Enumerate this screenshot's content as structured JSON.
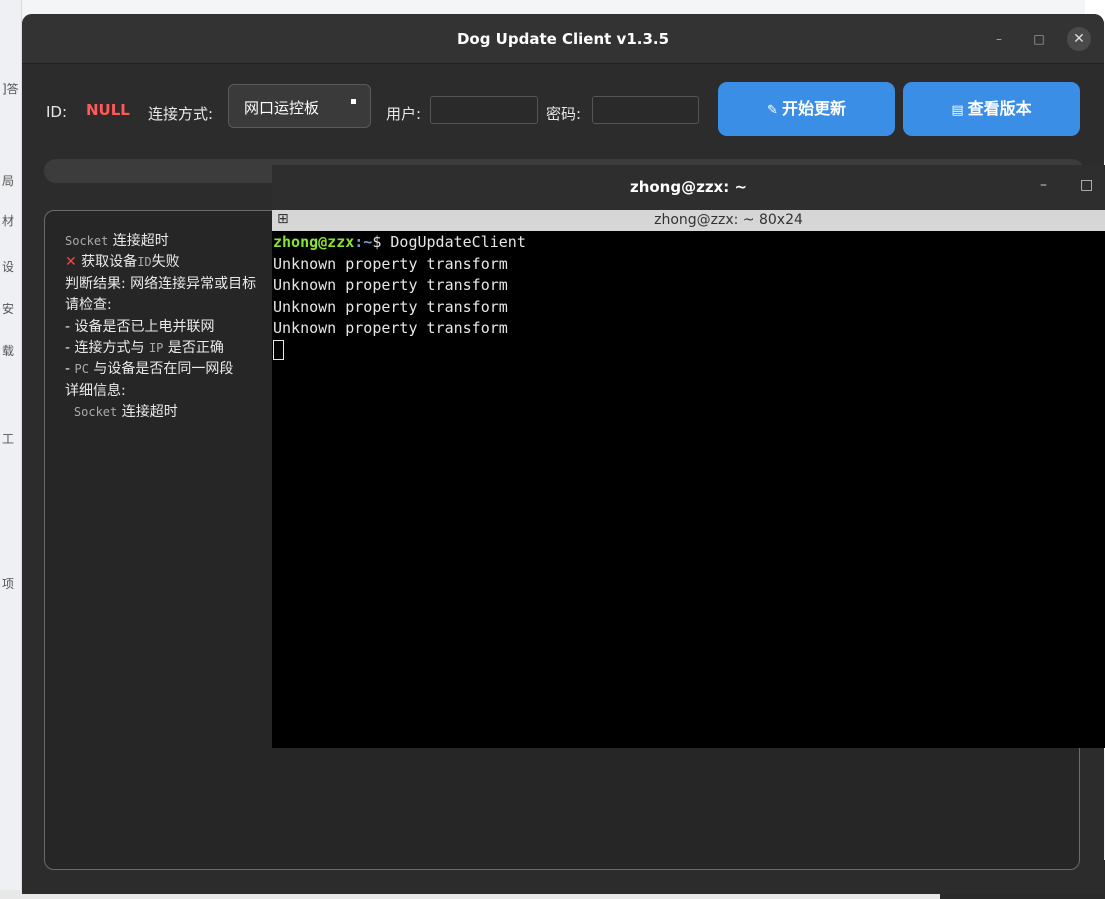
{
  "app": {
    "title": "Dog Update Client v1.3.5",
    "minimize": "–",
    "maximize": "□",
    "close": "✕"
  },
  "toolbar": {
    "id_label": "ID:",
    "id_value": "NULL",
    "conn_label": "连接方式:",
    "conn_value": "网口运控板",
    "user_label": "用户:",
    "user_value": "",
    "pass_label": "密码:",
    "pass_value": "",
    "start_button": "开始更新",
    "start_icon": "pencil-icon",
    "start_icon_glyph": "✎",
    "version_button": "查看版本",
    "version_icon": "document-icon",
    "version_icon_glyph": "▤"
  },
  "log": {
    "lines": [
      [
        "Socket",
        " 连接超时"
      ],
      [
        "✕",
        " 获取设备",
        "ID",
        "失败"
      ],
      [
        "判断结果: 网络连接异常或目标"
      ],
      [
        "请检查:"
      ],
      [
        "- 设备是否已上电并联网"
      ],
      [
        "- 连接方式与 ",
        "IP",
        " 是否正确"
      ],
      [
        "- ",
        "PC",
        " 与设备是否在同一网段"
      ],
      [
        "详细信息:"
      ],
      [
        "  ",
        "Socket",
        " 连接超时"
      ]
    ]
  },
  "terminal": {
    "title": "zhong@zzx: ~",
    "tab_title": "zhong@zzx: ~ 80x24",
    "minimize": "–",
    "maximize": "□",
    "prompt_user": "zhong@zzx",
    "prompt_path": ":~",
    "prompt_symbol": "$ ",
    "command": "DogUpdateClient",
    "output": [
      "Unknown property transform",
      "Unknown property transform",
      "Unknown property transform",
      "Unknown property transform"
    ]
  },
  "colors": {
    "accent": "#3a8ee6",
    "error": "#ff5a5a",
    "prompt_user": "#8ae234",
    "prompt_path": "#729fcf"
  }
}
